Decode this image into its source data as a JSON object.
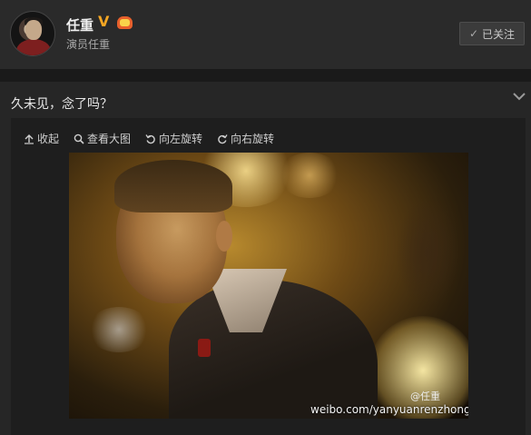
{
  "profile": {
    "name": "任重",
    "subtitle": "演员任重",
    "follow_label": "已关注",
    "verified_badge": "V",
    "icons": [
      "verified-icon",
      "vip-icon",
      "check-icon"
    ]
  },
  "post": {
    "text": "久未见，念了吗？",
    "toolbar": [
      {
        "icon": "collapse-arrow-icon",
        "label": "收起"
      },
      {
        "icon": "magnifier-icon",
        "label": "查看大图"
      },
      {
        "icon": "rotate-left-icon",
        "label": "向左旋转"
      },
      {
        "icon": "rotate-right-icon",
        "label": "向右旋转"
      }
    ],
    "photo": {
      "watermark_logo": "@任重",
      "watermark_url": "weibo.com/yanyuanrenzhong"
    }
  },
  "colors": {
    "background": "#1c1c1c",
    "panel": "#262626",
    "accent_badge": "#f5a623"
  }
}
